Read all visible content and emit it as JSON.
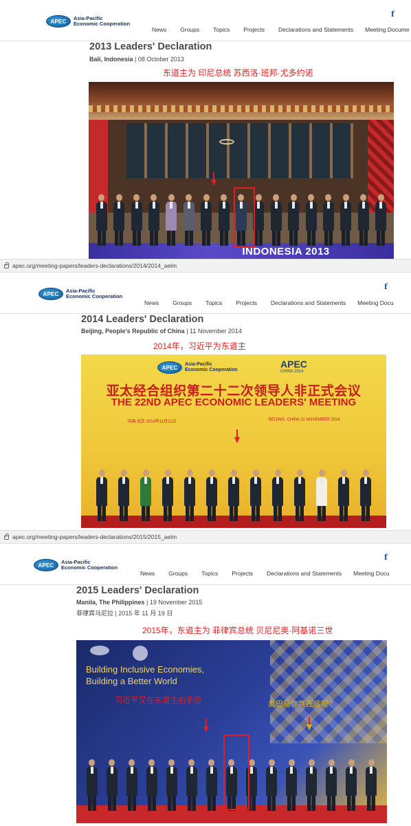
{
  "nav": {
    "logo_badge": "APEC",
    "logo_line1": "Asia-Pacific",
    "logo_line2": "Economic Cooperation",
    "links": [
      "News",
      "Groups",
      "Topics",
      "Projects",
      "Declarations and Statements",
      "Meeting Docume"
    ],
    "links_cut": [
      "News",
      "Groups",
      "Topics",
      "Projects",
      "Declarations and Statements",
      "Meeting Docu"
    ],
    "facebook_icon": "f"
  },
  "panel2013": {
    "title": "2013 Leaders' Declaration",
    "location": "Bali, Indonesia",
    "date": "| 08 October 2013",
    "caption": "东道主为 印尼总统 苏西洛·班邦·尤多约诺",
    "banner": "INDONESIA 2013"
  },
  "url1": "apec.org/meeting-papers/leaders-declarations/2014/2014_aelm",
  "panel2014": {
    "title": "2014 Leaders' Declaration",
    "location": "Beijing, People's Republic of China",
    "date": "| 11 November 2014",
    "caption": "2014年，习近平为东道主",
    "banner_logo_line1": "Asia-Pacific",
    "banner_logo_line2": "Economic Cooperation",
    "banner_apec": "APEC",
    "banner_china": "CHINA 2014",
    "banner_cn": "亚太经合组织第二十二次领导人非正式会议",
    "banner_en": "THE 22ND APEC ECONOMIC LEADERS' MEETING",
    "banner_date_cn": "中国 北京  2014年11月11日",
    "banner_date_en": "BEIJING, CHINA  11 NOVEMBER 2014"
  },
  "url2": "apec.org/meeting-papers/leaders-declarations/2015/2015_aelm",
  "panel2015": {
    "title": "2015 Leaders' Declaration",
    "location": "Manila, The Philippines",
    "date": "| 19 November 2015",
    "subtitle_cn": "菲律宾马尼拉 | 2015 年 11 月 19 日",
    "caption": "2015年，东道主为 菲律宾总统 贝尼尼奥·阿基诺三世",
    "banner_line1": "Building Inclusive Economies,",
    "banner_line2": "Building a Better World",
    "annotation_left": "习近平又在东道主右手边",
    "annotation_right": "奥巴马你咋在这呢?"
  },
  "colors": {
    "accent_red": "#e02020",
    "apec_blue": "#0a5a9c",
    "facebook_blue": "#1d4fa0"
  }
}
